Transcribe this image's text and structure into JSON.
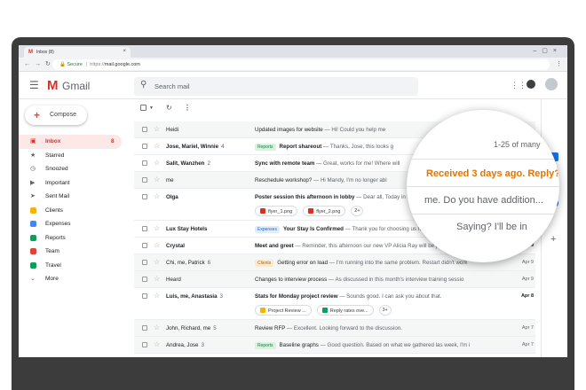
{
  "browser": {
    "tab_title": "Inbox (8)",
    "url_secure": "Secure",
    "url_proto": "https://",
    "url_host": "mail.google.com"
  },
  "header": {
    "logo_text": "Gmail",
    "search_placeholder": "Search mail"
  },
  "sidebar": {
    "compose_label": "Compose",
    "items": [
      {
        "label": "Inbox",
        "count": "8",
        "icon": "inbox-icon",
        "color": "#d93025"
      },
      {
        "label": "Starred",
        "count": "",
        "icon": "star-icon",
        "color": "#5f6368"
      },
      {
        "label": "Snoozed",
        "count": "",
        "icon": "clock-icon",
        "color": "#5f6368"
      },
      {
        "label": "Important",
        "count": "",
        "icon": "important-icon",
        "color": "#5f6368"
      },
      {
        "label": "Sent Mail",
        "count": "",
        "icon": "send-icon",
        "color": "#5f6368"
      },
      {
        "label": "Clients",
        "count": "",
        "icon": "label-icon",
        "color": "#f4b400"
      },
      {
        "label": "Expenses",
        "count": "",
        "icon": "label-icon",
        "color": "#4285f4"
      },
      {
        "label": "Reports",
        "count": "",
        "icon": "label-icon",
        "color": "#0f9d58"
      },
      {
        "label": "Team",
        "count": "",
        "icon": "label-icon",
        "color": "#db4437"
      },
      {
        "label": "Travel",
        "count": "",
        "icon": "label-icon",
        "color": "#0f9d58"
      },
      {
        "label": "More",
        "count": "",
        "icon": "chevron-down-icon",
        "color": "#5f6368"
      }
    ]
  },
  "emails": [
    {
      "sender": "Heidi",
      "count": "",
      "label": "",
      "subject": "Updated images for website",
      "snippet": " — Hi! Could you help me",
      "date": "",
      "unread": false,
      "chips": []
    },
    {
      "sender": "Jose, Mariel, Winnie",
      "count": "4",
      "label": "Reports",
      "subject": "Report shareout",
      "snippet": " — Thanks, Jose, this looks g",
      "date": "",
      "unread": true,
      "chips": []
    },
    {
      "sender": "Salit, Wanzhen",
      "count": "2",
      "label": "",
      "subject": "Sync with remote team",
      "snippet": " — Great, works for me! Where will",
      "date": "Apr 10",
      "unread": true,
      "chips": []
    },
    {
      "sender": "me",
      "count": "",
      "label": "",
      "subject": "Reschedule workshop?",
      "snippet": " — Hi Mandy, I'm no longer abl",
      "date": "Apr 7",
      "unread": false,
      "chips": []
    },
    {
      "sender": "Olga",
      "count": "",
      "label": "",
      "subject": "Poster session this afternoon in lobby",
      "snippet": " — Dear all, Today in the first floor lobby we will",
      "date": "Apr 10",
      "unread": true,
      "chips": [
        "flyer_1.png",
        "flyer_2.png"
      ],
      "more": "2+"
    },
    {
      "sender": "Lux Stay Hotels",
      "count": "",
      "label": "Expenses",
      "subject": "Your Stay Is Confirmed",
      "snippet": " — Thank you for choosing us for your business tri",
      "date": "Apr 10",
      "unread": true,
      "chips": []
    },
    {
      "sender": "Crystal",
      "count": "",
      "label": "",
      "subject": "Meet and greet",
      "snippet": " — Reminder, this afternoon our new VP Alicia Ray will be joining us for",
      "date": "Apr 9",
      "unread": true,
      "chips": []
    },
    {
      "sender": "Chi, me, Patrick",
      "count": "6",
      "label": "Clients",
      "subject": "Getting error on load",
      "snippet": " — I'm running into the same problem. Restart didn't work",
      "date": "Apr 9",
      "unread": false,
      "chips": []
    },
    {
      "sender": "Heard",
      "count": "",
      "label": "",
      "subject": "Changes to interview process",
      "snippet": " — As discussed in this month's interview training sessio",
      "date": "Apr 9",
      "unread": false,
      "chips": []
    },
    {
      "sender": "Luis, me, Anastasia",
      "count": "3",
      "label": "",
      "subject": "Stats for Monday project review",
      "snippet": " — Sounds good. I can ask you about that.",
      "date": "Apr 8",
      "unread": true,
      "chips": [
        "Project Review ...",
        "Reply rates ove..."
      ],
      "more": "3+"
    },
    {
      "sender": "John, Richard, me",
      "count": "5",
      "label": "",
      "subject": "Review RFP",
      "snippet": " — Excellent. Looking forward to the discussion.",
      "date": "Apr 7",
      "unread": false,
      "chips": []
    },
    {
      "sender": "Andrea, Jose",
      "count": "3",
      "label": "Reports",
      "subject": "Baseline graphs",
      "snippet": " — Good question. Based on what we gathered las week, I'm i",
      "date": "Apr 7",
      "unread": false,
      "chips": []
    }
  ],
  "magnifier": {
    "page_count": "1-25 of many",
    "nudge": "Received 3 days ago. Reply?",
    "line2": "me. Do you have addition...",
    "line3": "Saying? I'll be in"
  }
}
